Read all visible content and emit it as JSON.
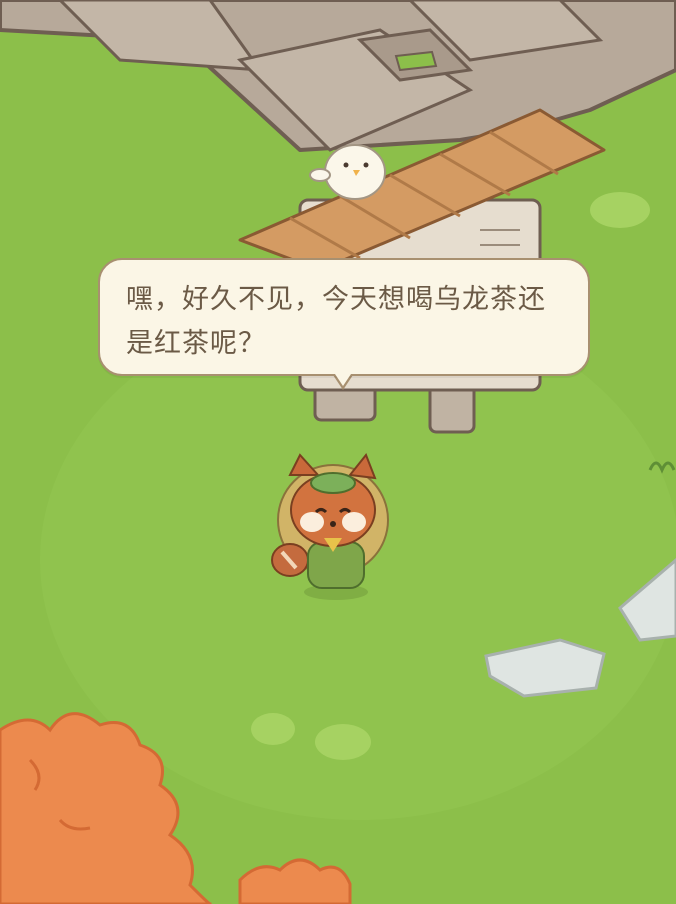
{
  "dialogue": {
    "text": "嘿，好久不见，今天想喝乌龙茶还是红茶呢？"
  },
  "colors": {
    "grass": "#8cbf4a",
    "stone_path": "#b7a99a",
    "roof": "#d49b63",
    "bubble_bg": "#fbf6e6",
    "bush": "#ec8a4e"
  }
}
